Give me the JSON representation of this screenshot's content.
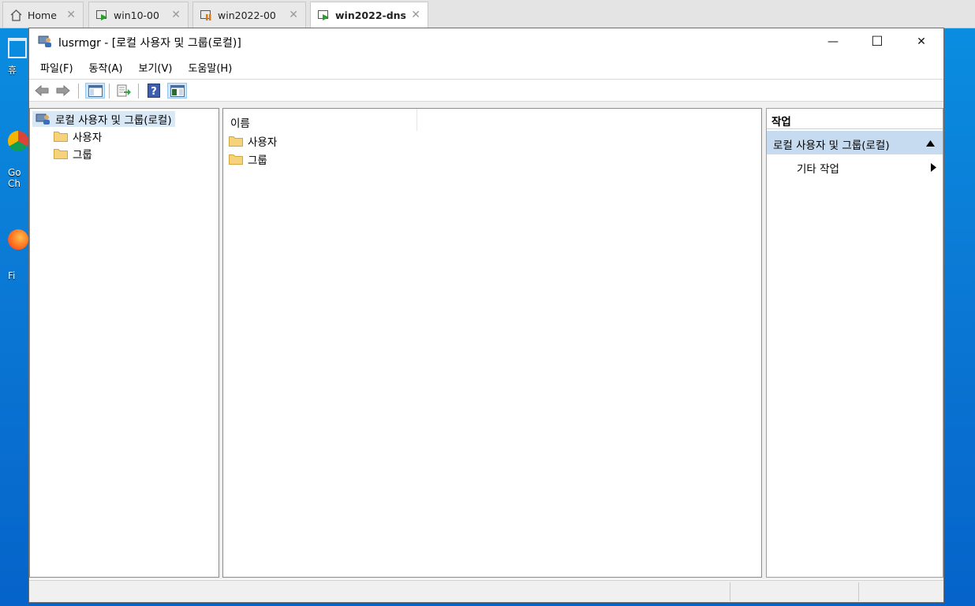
{
  "host_tabs": [
    {
      "label": "Home",
      "icon": "home-icon"
    },
    {
      "label": "win10-00",
      "icon": "vm-running-icon"
    },
    {
      "label": "win2022-00",
      "icon": "vm-paused-icon"
    },
    {
      "label": "win2022-dns",
      "icon": "vm-running-icon"
    }
  ],
  "desktop_icons": [
    {
      "label": "휴"
    },
    {
      "label": "Go Ch"
    },
    {
      "label": "Fi"
    }
  ],
  "window": {
    "title": "lusrmgr - [로컬 사용자 및 그룹(로컬)]",
    "controls": {
      "minimize": "—",
      "maximize": "☐",
      "close": "✕"
    }
  },
  "menu": [
    "파일(F)",
    "동작(A)",
    "보기(V)",
    "도움말(H)"
  ],
  "toolbar": [
    "back-icon",
    "forward-icon",
    "show-hide-tree-icon",
    "export-list-icon",
    "help-icon",
    "show-hide-action-pane-icon"
  ],
  "tree": {
    "root": "로컬 사용자 및 그룹(로컬)",
    "children": [
      "사용자",
      "그룹"
    ]
  },
  "list": {
    "column_name": "이름",
    "items": [
      "사용자",
      "그룹"
    ]
  },
  "actions": {
    "header": "작업",
    "section": "로컬 사용자 및 그룹(로컬)",
    "item": "기타 작업"
  },
  "colors": {
    "selected_tree_bg": "#d9e8f7",
    "action_section_bg": "#c6dbef",
    "desktop_bg": "#0b7bd6"
  }
}
